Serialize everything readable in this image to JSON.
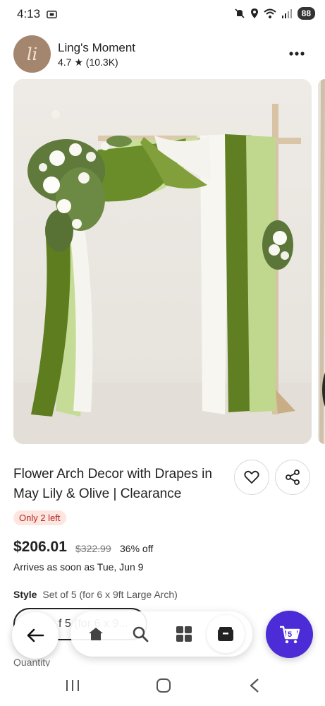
{
  "status_bar": {
    "time": "4:13",
    "battery": "88"
  },
  "shop": {
    "name": "Ling's Moment",
    "rating": "4.7 ★ (10.3K)",
    "avatar_initials": "li"
  },
  "product": {
    "title": "Flower Arch Decor with Drapes in May Lily & Olive | Clearance",
    "stock_badge": "Only 2 left",
    "price": "$206.01",
    "original_price": "$322.99",
    "discount": "36% off",
    "arrival": "Arrives as soon as Tue, Jun 9",
    "style_label": "Style",
    "style_value": "Set of 5 (for 6 x 9ft Large Arch)",
    "variant_select_value": "f 5 (for 6 x 9...",
    "quantity_label": "Quantity"
  },
  "cart": {
    "count": "5"
  },
  "icons": {
    "more": "more-vertical-icon",
    "favorite": "heart-icon",
    "share": "share-icon",
    "back": "arrow-left-icon",
    "home": "home-icon",
    "search": "search-icon",
    "categories": "grid-icon",
    "orders": "package-icon",
    "cart": "cart-icon"
  },
  "colors": {
    "accent": "#4b2cd6",
    "badge_bg": "#fde5e0",
    "badge_text": "#b3261e",
    "olive": "#5e7d1f",
    "sage": "#bcd58a"
  }
}
